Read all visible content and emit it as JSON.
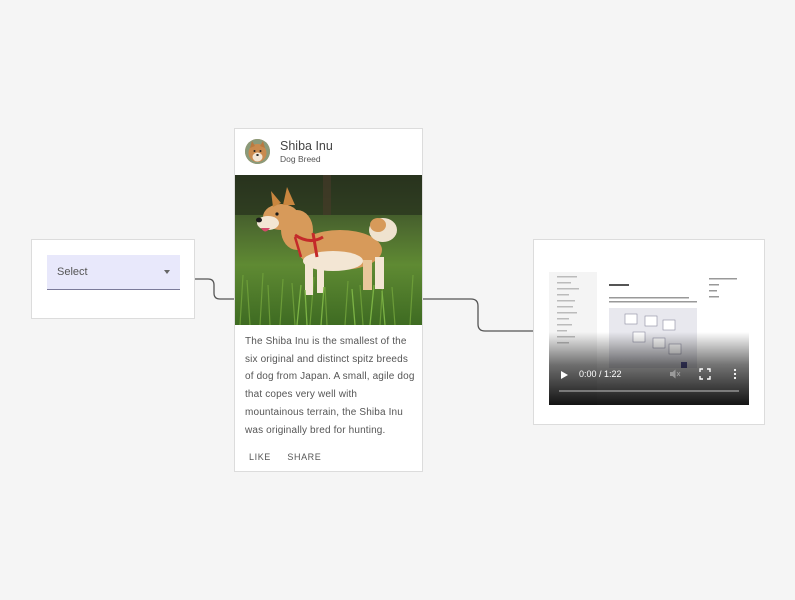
{
  "select": {
    "label": "Select"
  },
  "card": {
    "title": "Shiba Inu",
    "subtitle": "Dog Breed",
    "body": "The Shiba Inu is the smallest of the six original and distinct spitz breeds of dog from Japan. A small, agile dog that copes very well with mountainous terrain, the Shiba Inu was originally bred for hunting.",
    "actions": {
      "like": "LIKE",
      "share": "SHARE"
    }
  },
  "video": {
    "time": "0:00 / 1:22",
    "progress": 0
  },
  "icons": {
    "play": "play-icon",
    "mute": "volume-muted-icon",
    "fullscreen": "fullscreen-icon",
    "more": "more-vertical-icon",
    "dropdown": "dropdown-arrow-icon"
  },
  "colors": {
    "canvas": "#f5f5f5",
    "select_fill": "#e8e8fb",
    "edge": "#555555"
  }
}
